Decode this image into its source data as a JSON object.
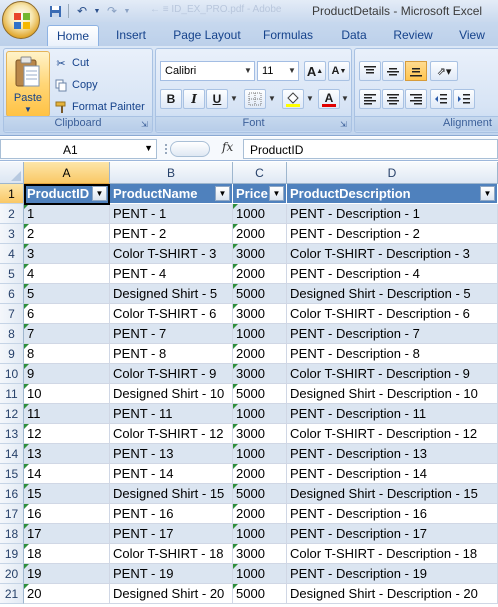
{
  "window": {
    "title": "ProductDetails - Microsoft Excel",
    "ghost_path": "← ≡ ID_EX_PRO.pdf - Adobe"
  },
  "tabs": [
    {
      "label": "Home",
      "active": true
    },
    {
      "label": "Insert"
    },
    {
      "label": "Page Layout"
    },
    {
      "label": "Formulas"
    },
    {
      "label": "Data"
    },
    {
      "label": "Review"
    },
    {
      "label": "View"
    }
  ],
  "ribbon": {
    "clipboard": {
      "label": "Clipboard",
      "paste": "Paste",
      "cut": "Cut",
      "copy": "Copy",
      "format_painter": "Format Painter"
    },
    "font": {
      "label": "Font",
      "font_name": "Calibri",
      "font_size": "11",
      "bold": "B",
      "italic": "I",
      "underline": "U",
      "grow": "A",
      "shrink": "A",
      "font_color": "A"
    },
    "alignment": {
      "label": "Alignment"
    }
  },
  "formula_bar": {
    "name_box": "A1",
    "fx": "fx",
    "content": "ProductID"
  },
  "sheet": {
    "columns": [
      "A",
      "B",
      "C",
      "D"
    ],
    "selected_column": "A",
    "selected_row": "1",
    "headers": [
      "ProductID",
      "ProductName",
      "Price",
      "ProductDescription"
    ],
    "rows": [
      [
        "1",
        "PENT - 1",
        "1000",
        "PENT - Description - 1"
      ],
      [
        "2",
        "PENT - 2",
        "2000",
        "PENT - Description - 2"
      ],
      [
        "3",
        "Color T-SHIRT - 3",
        "3000",
        "Color T-SHIRT - Description - 3"
      ],
      [
        "4",
        "PENT - 4",
        "2000",
        "PENT - Description - 4"
      ],
      [
        "5",
        "Designed Shirt - 5",
        "5000",
        "Designed Shirt - Description - 5"
      ],
      [
        "6",
        "Color T-SHIRT - 6",
        "3000",
        "Color T-SHIRT - Description - 6"
      ],
      [
        "7",
        "PENT - 7",
        "1000",
        "PENT - Description - 7"
      ],
      [
        "8",
        "PENT - 8",
        "2000",
        "PENT - Description - 8"
      ],
      [
        "9",
        "Color T-SHIRT - 9",
        "3000",
        "Color T-SHIRT - Description - 9"
      ],
      [
        "10",
        "Designed Shirt - 10",
        "5000",
        "Designed Shirt - Description - 10"
      ],
      [
        "11",
        "PENT - 11",
        "1000",
        "PENT - Description - 11"
      ],
      [
        "12",
        "Color T-SHIRT - 12",
        "3000",
        "Color T-SHIRT - Description - 12"
      ],
      [
        "13",
        "PENT - 13",
        "1000",
        "PENT - Description - 13"
      ],
      [
        "14",
        "PENT - 14",
        "2000",
        "PENT - Description - 14"
      ],
      [
        "15",
        "Designed Shirt - 15",
        "5000",
        "Designed Shirt - Description - 15"
      ],
      [
        "16",
        "PENT - 16",
        "2000",
        "PENT - Description - 16"
      ],
      [
        "17",
        "PENT - 17",
        "1000",
        "PENT - Description - 17"
      ],
      [
        "18",
        "Color T-SHIRT - 18",
        "3000",
        "Color T-SHIRT - Description - 18"
      ],
      [
        "19",
        "PENT - 19",
        "1000",
        "PENT - Description - 19"
      ],
      [
        "20",
        "Designed Shirt - 20",
        "5000",
        "Designed Shirt - Description - 20"
      ]
    ]
  },
  "colors": {
    "table_header": "#4f81bd",
    "table_band": "#dbe5f1",
    "selection": "#f9c866"
  }
}
